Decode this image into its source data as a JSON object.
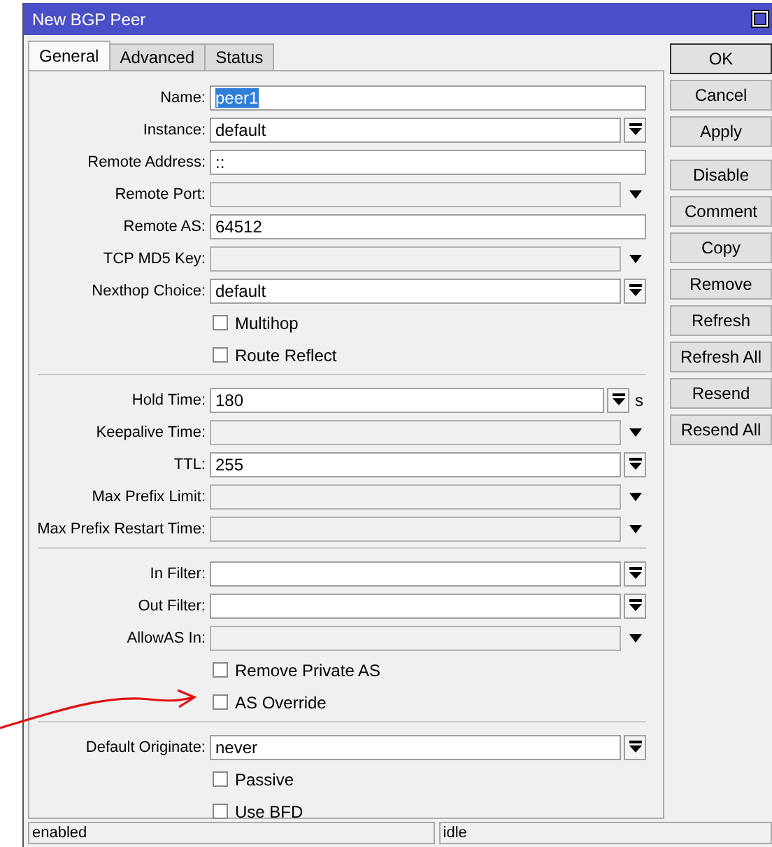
{
  "window": {
    "title": "New BGP Peer"
  },
  "tabs": [
    {
      "label": "General",
      "selected": true
    },
    {
      "label": "Advanced",
      "selected": false
    },
    {
      "label": "Status",
      "selected": false
    }
  ],
  "sections": [
    {
      "rows": [
        {
          "kind": "text",
          "label": "Name:",
          "value": "peer1",
          "highlighted": true
        },
        {
          "kind": "combo",
          "label": "Instance:",
          "value": "default"
        },
        {
          "kind": "text",
          "label": "Remote Address:",
          "value": "::",
          "highlighted": false
        },
        {
          "kind": "disabled",
          "label": "Remote Port:"
        },
        {
          "kind": "text",
          "label": "Remote AS:",
          "value": "64512",
          "highlighted": false
        },
        {
          "kind": "disabled",
          "label": "TCP MD5 Key:"
        },
        {
          "kind": "combo",
          "label": "Nexthop Choice:",
          "value": "default"
        },
        {
          "kind": "check",
          "label": "Multihop",
          "checked": false
        },
        {
          "kind": "check",
          "label": "Route Reflect",
          "checked": false
        }
      ]
    },
    {
      "rows": [
        {
          "kind": "combo",
          "label": "Hold Time:",
          "value": "180",
          "unit": "s"
        },
        {
          "kind": "disabled",
          "label": "Keepalive Time:"
        },
        {
          "kind": "combo",
          "label": "TTL:",
          "value": "255"
        },
        {
          "kind": "disabled",
          "label": "Max Prefix Limit:"
        },
        {
          "kind": "disabled",
          "label": "Max Prefix Restart Time:"
        }
      ]
    },
    {
      "rows": [
        {
          "kind": "combo",
          "label": "In Filter:",
          "value": ""
        },
        {
          "kind": "combo",
          "label": "Out Filter:",
          "value": ""
        },
        {
          "kind": "disabled",
          "label": "AllowAS In:"
        },
        {
          "kind": "check",
          "label": "Remove Private AS",
          "checked": false
        },
        {
          "kind": "check",
          "label": "AS Override",
          "checked": false
        }
      ]
    },
    {
      "rows": [
        {
          "kind": "combo",
          "label": "Default Originate:",
          "value": "never"
        },
        {
          "kind": "check",
          "label": "Passive",
          "checked": false
        },
        {
          "kind": "check",
          "label": "Use BFD",
          "checked": false
        }
      ]
    }
  ],
  "button_groups": [
    [
      "OK",
      "Cancel",
      "Apply"
    ],
    [
      "Disable",
      "Comment",
      "Copy",
      "Remove",
      "Refresh",
      "Refresh All",
      "Resend",
      "Resend All"
    ]
  ],
  "status_bar": [
    "enabled",
    "idle"
  ]
}
